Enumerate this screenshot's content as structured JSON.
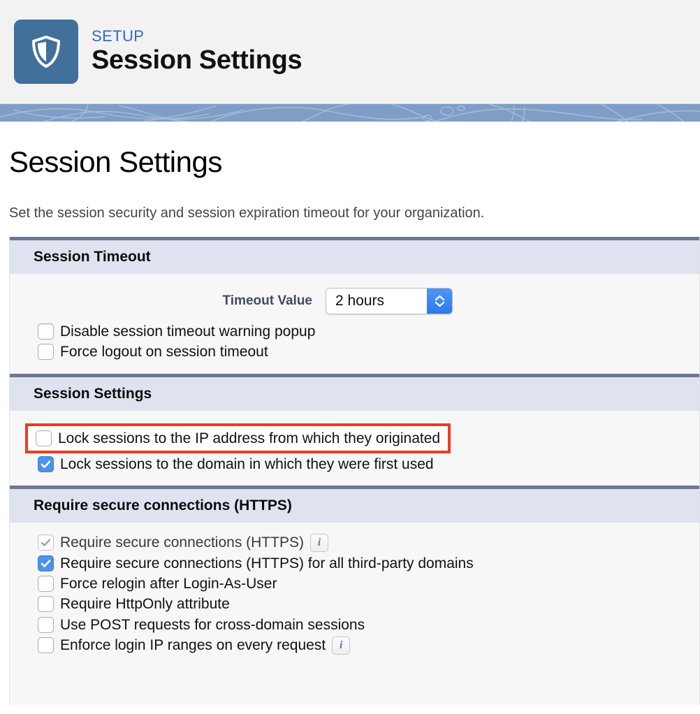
{
  "header": {
    "eyebrow": "SETUP",
    "title": "Session Settings",
    "icon": "shield-icon",
    "tile_color": "#41709B",
    "eyebrow_color": "#2E6BC6"
  },
  "page": {
    "title": "Session Settings",
    "description": "Set the session security and session expiration timeout for your organization."
  },
  "annotation": {
    "highlight_color": "#EE3B21",
    "target": "Lock sessions to the IP address from which they originated"
  },
  "sections": [
    {
      "id": "session-timeout",
      "title": "Session Timeout",
      "timeout_field": {
        "label": "Timeout Value",
        "value": "2 hours",
        "stepper_color": "#2a7bee"
      },
      "checkboxes": [
        {
          "label": "Disable session timeout warning popup",
          "checked": false,
          "disabled": false,
          "info": false
        },
        {
          "label": "Force logout on session timeout",
          "checked": false,
          "disabled": false,
          "info": false
        }
      ]
    },
    {
      "id": "session-settings",
      "title": "Session Settings",
      "checkboxes": [
        {
          "label": "Lock sessions to the IP address from which they originated",
          "checked": false,
          "disabled": false,
          "info": false,
          "highlighted": true
        },
        {
          "label": "Lock sessions to the domain in which they were first used",
          "checked": true,
          "disabled": false,
          "info": false
        }
      ]
    },
    {
      "id": "require-secure-connections",
      "title": "Require secure connections (HTTPS)",
      "checkboxes": [
        {
          "label": "Require secure connections (HTTPS)",
          "checked": true,
          "disabled": true,
          "info": true
        },
        {
          "label": "Require secure connections (HTTPS) for all third-party domains",
          "checked": true,
          "disabled": false,
          "info": false
        },
        {
          "label": "Force relogin after Login-As-User",
          "checked": false,
          "disabled": false,
          "info": false
        },
        {
          "label": "Require HttpOnly attribute",
          "checked": false,
          "disabled": false,
          "info": false
        },
        {
          "label": "Use POST requests for cross-domain sessions",
          "checked": false,
          "disabled": false,
          "info": false
        },
        {
          "label": "Enforce login IP ranges on every request",
          "checked": false,
          "disabled": false,
          "info": true
        }
      ]
    }
  ],
  "icons": {
    "info": "i",
    "stepper_up": "chevron-up-icon",
    "stepper_down": "chevron-down-icon"
  }
}
